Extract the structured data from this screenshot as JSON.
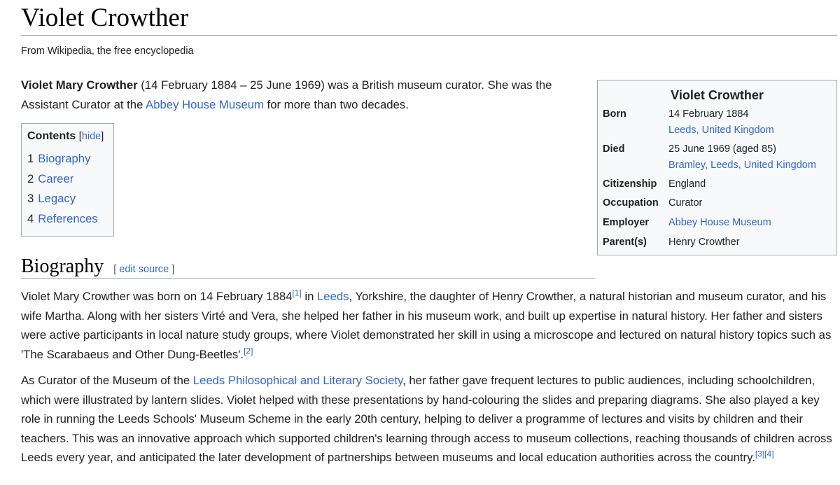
{
  "article": {
    "title": "Violet Crowther",
    "tagline": "From Wikipedia, the free encyclopedia"
  },
  "lead": {
    "bold_name": "Violet Mary Crowther",
    "t1": " (14 February 1884 – 25 June 1969) was a British museum curator. She was the Assistant Curator at the ",
    "link_museum": "Abbey House Museum",
    "t2": " for more than two decades."
  },
  "toc": {
    "title": "Contents",
    "toggle_open": "[",
    "toggle_label": "hide",
    "toggle_close": "]",
    "items": [
      {
        "num": "1",
        "label": "Biography"
      },
      {
        "num": "2",
        "label": "Career"
      },
      {
        "num": "3",
        "label": "Legacy"
      },
      {
        "num": "4",
        "label": "References"
      }
    ]
  },
  "infobox": {
    "title": "Violet Crowther",
    "born_label": "Born",
    "born_date": "14 February 1884",
    "born_place_1": "Leeds",
    "born_place_sep": ", ",
    "born_place_2": "United Kingdom",
    "died_label": "Died",
    "died_date": "25 June 1969 (aged 85)",
    "died_place_1": "Bramley",
    "died_place_sep1": ", ",
    "died_place_2": "Leeds",
    "died_place_sep2": ", ",
    "died_place_3": "United Kingdom",
    "citizenship_label": "Citizenship",
    "citizenship_value": "England",
    "occupation_label": "Occupation",
    "occupation_value": "Curator",
    "employer_label": "Employer",
    "employer_value": "Abbey House Museum",
    "parents_label": "Parent(s)",
    "parents_value": "Henry Crowther"
  },
  "biography": {
    "heading": "Biography",
    "edit_open": "[ ",
    "edit_label": "edit source",
    "edit_close": " ]",
    "p1_a": "Violet Mary Crowther was born on 14 February 1884",
    "p1_ref1": "[1]",
    "p1_b": " in ",
    "p1_link_leeds": "Leeds",
    "p1_c": ", Yorkshire, the daughter of Henry Crowther, a natural historian and museum curator, and his wife Martha. Along with her sisters Virté and Vera, she helped her father in his museum work, and built up expertise in natural history. Her father and sisters were active participants in local nature study groups, where Violet demonstrated her skill in using a microscope and lectured on natural history topics such as 'The Scarabaeus and Other Dung-Beetles'.",
    "p1_ref2": "[2]",
    "p2_a": "As Curator of the Museum of the ",
    "p2_link": "Leeds Philosophical and Literary Society",
    "p2_b": ", her father gave frequent lectures to public audiences, including schoolchildren, which were illustrated by lantern slides. Violet helped with these presentations by hand-colouring the slides and preparing diagrams. She also played a key role in running the Leeds Schools' Museum Scheme in the early 20th century, helping to deliver a programme of lectures and visits by children and their teachers. This was an innovative approach which supported children's learning through access to museum collections, reaching thousands of children across Leeds every year, and anticipated the later development of partnerships between museums and local education authorities across the country.",
    "p2_ref3": "[3]",
    "p2_ref4": "[4]"
  },
  "colors": {
    "link": "#3366cc",
    "text": "#202122",
    "border": "#a2a9b1",
    "box_bg": "#f8f9fa"
  }
}
